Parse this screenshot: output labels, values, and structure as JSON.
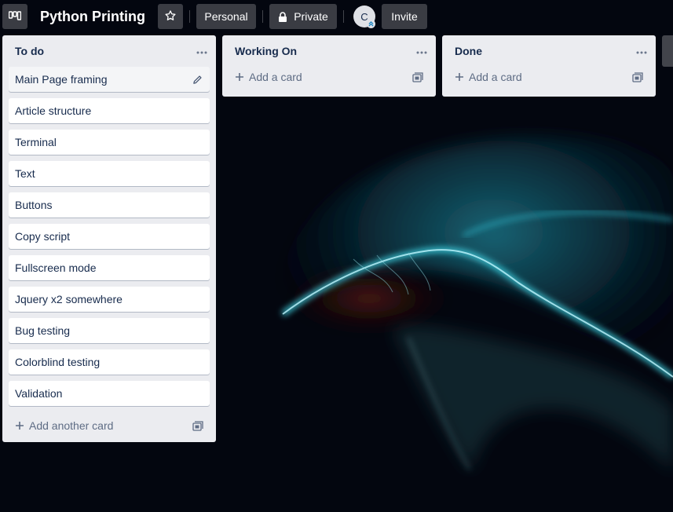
{
  "header": {
    "title": "Python Printing",
    "workspace_label": "Personal",
    "visibility_label": "Private",
    "avatar_initial": "C",
    "invite_label": "Invite"
  },
  "lists": [
    {
      "title": "To do",
      "cards": [
        "Main Page framing",
        "Article structure",
        "Terminal",
        "Text",
        "Buttons",
        "Copy script",
        "Fullscreen mode",
        "Jquery x2 somewhere",
        "Bug testing",
        "Colorblind testing",
        "Validation"
      ],
      "add_label": "Add another card"
    },
    {
      "title": "Working On",
      "cards": [],
      "add_label": "Add a card"
    },
    {
      "title": "Done",
      "cards": [],
      "add_label": "Add a card"
    }
  ],
  "icons": {
    "boards": "boards-icon",
    "star": "star-icon",
    "lock": "lock-icon",
    "more": "more-horizontal-icon",
    "pencil": "pencil-icon",
    "plus": "plus-icon",
    "template": "template-card-icon"
  },
  "colors": {
    "list_bg": "#ebecf0",
    "card_bg": "#ffffff",
    "text": "#172b4d",
    "muted": "#5e6c84",
    "board_bg": "#03060f",
    "jellyfish_glow": "#3fd6e6"
  }
}
